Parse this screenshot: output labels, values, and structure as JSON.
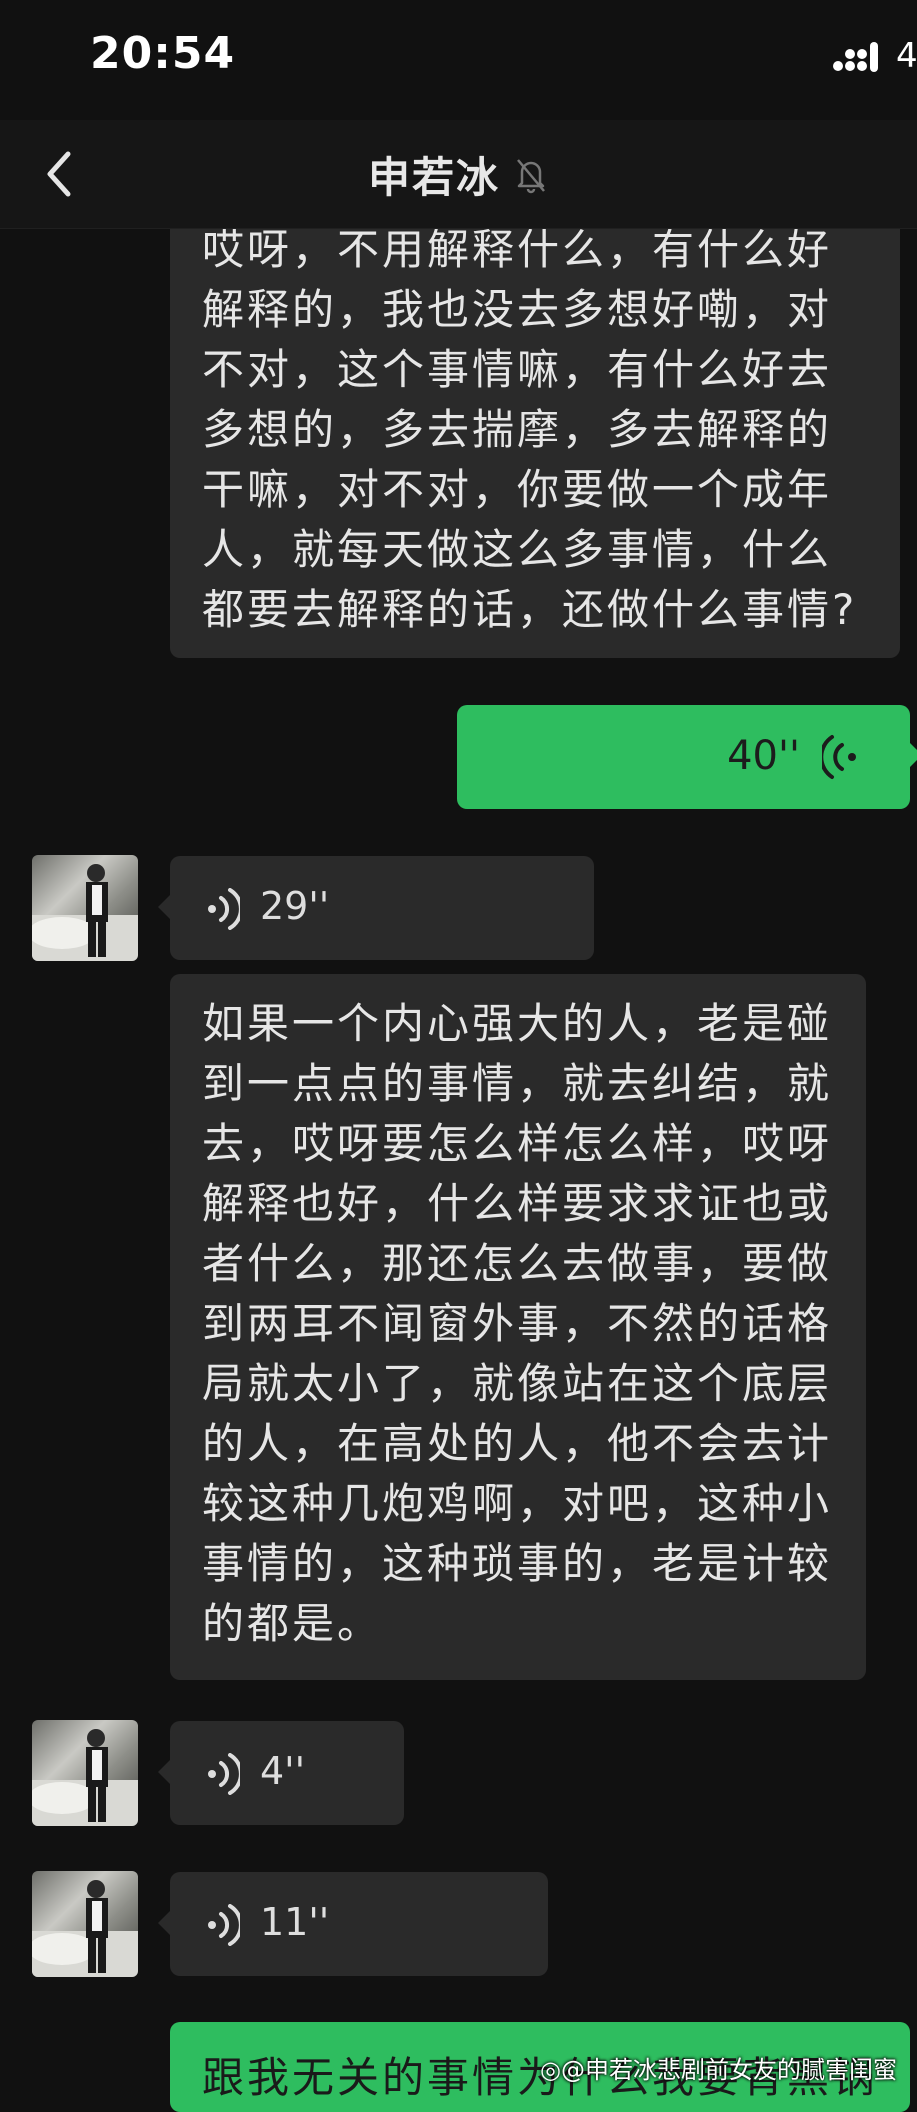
{
  "status_bar": {
    "time": "20:54",
    "network": "4"
  },
  "nav": {
    "title": "申若冰"
  },
  "messages": {
    "text1": "哎呀，不用解释什么，有什么好\n解释的，我也没去多想好嘞，对\n不对，这个事情嘛，有什么好去\n多想的，多去揣摩，多去解释的\n干嘛，对不对，你要做一个成年\n人，就每天做这么多事情，什么\n都要去解释的话，还做什么事情?",
    "voice_out_duration": "40''",
    "voice_in_1_duration": "29''",
    "text2": "如果一个内心强大的人，老是碰\n到一点点的事情，就去纠结，就\n去，哎呀要怎么样怎么样，哎呀\n解释也好，什么样要求求证也或\n者什么，那还怎么去做事，要做\n到两耳不闻窗外事，不然的话格\n局就太小了，就像站在这个底层\n的人，在高处的人，他不会去计\n较这种几炮鸡啊，对吧，这种小\n事情的，这种琐事的，老是计较\n的都是。",
    "voice_in_2_duration": "4''",
    "voice_in_3_duration": "11''",
    "text3": "跟我无关的事情为什么我要背黑锅"
  },
  "watermark": "@申若冰悲剧前女友的腻害闺蜜",
  "colors": {
    "background": "#111111",
    "bubble_in": "#2a2a2a",
    "bubble_out": "#2ebd5f"
  },
  "icons": [
    "back-chevron-icon",
    "mute-bell-icon",
    "signal-icon",
    "voice-wave-icon",
    "weibo-icon"
  ]
}
